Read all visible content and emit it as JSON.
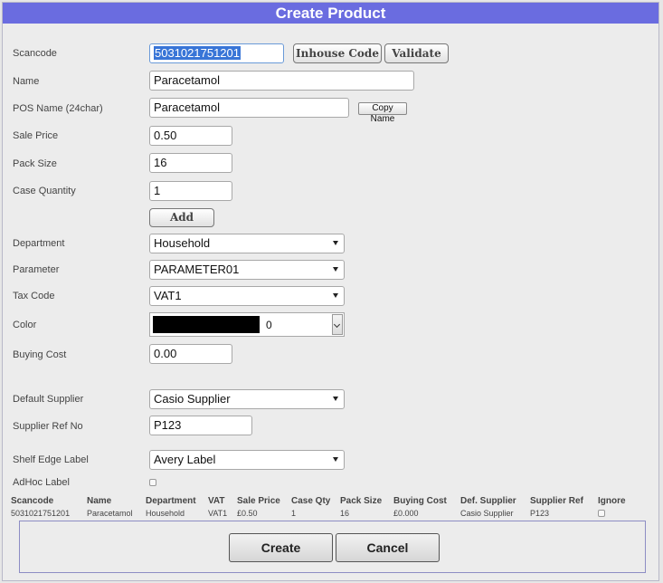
{
  "dialog": {
    "title": "Create Product"
  },
  "form": {
    "scancode": {
      "label": "Scancode",
      "value": "5031021751201"
    },
    "inhouse_code_button": "Inhouse Code",
    "validate_button": "Validate",
    "name": {
      "label": "Name",
      "value": "Paracetamol"
    },
    "pos_name": {
      "label": "POS Name (24char)",
      "value": "Paracetamol"
    },
    "copy_name_button": "Copy Name",
    "sale_price": {
      "label": "Sale Price",
      "value": "0.50"
    },
    "pack_size": {
      "label": "Pack Size",
      "value": "16"
    },
    "case_quantity": {
      "label": "Case Quantity",
      "value": "1"
    },
    "add_button": "Add",
    "department": {
      "label": "Department",
      "value": "Household"
    },
    "parameter": {
      "label": "Parameter",
      "value": "PARAMETER01"
    },
    "tax_code": {
      "label": "Tax Code",
      "value": "VAT1"
    },
    "color": {
      "label": "Color",
      "value": "0",
      "swatch": "#000000"
    },
    "buying_cost": {
      "label": "Buying Cost",
      "value": "0.00"
    },
    "default_supplier": {
      "label": "Default Supplier",
      "value": "Casio Supplier"
    },
    "supplier_ref": {
      "label": "Supplier Ref No",
      "value": "P123"
    },
    "shelf_edge_label": {
      "label": "Shelf Edge Label",
      "value": "Avery Label"
    },
    "adhoc_label": {
      "label": "AdHoc Label",
      "checked": false
    }
  },
  "table": {
    "headers": [
      "Scancode",
      "Name",
      "Department",
      "VAT",
      "Sale Price",
      "Case Qty",
      "Pack Size",
      "Buying Cost",
      "Def. Supplier",
      "Supplier Ref",
      "Ignore"
    ],
    "row": [
      "5031021751201",
      "Paracetamol",
      "Household",
      "VAT1",
      "£0.50",
      "1",
      "16",
      "£0.000",
      "Casio Supplier",
      "P123"
    ]
  },
  "footer": {
    "create_button": "Create",
    "cancel_button": "Cancel"
  },
  "colors": {
    "title_bar": "#6a6ce0",
    "selection": "#3875d7"
  }
}
